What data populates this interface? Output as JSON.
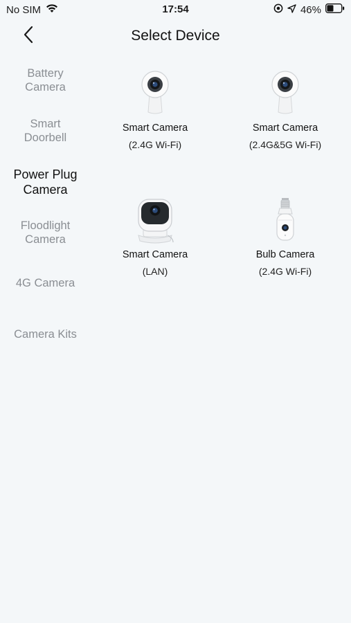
{
  "status_bar": {
    "carrier": "No SIM",
    "time": "17:54",
    "battery": "46%",
    "battery_level": 0.46,
    "icons": [
      "wifi-icon",
      "location-lock-icon",
      "location-arrow-icon",
      "battery-icon"
    ]
  },
  "nav": {
    "title": "Select Device",
    "back_icon": "chevron-left-icon"
  },
  "sidebar": {
    "active_index": 2,
    "items": [
      {
        "line1": "Battery",
        "line2": "Camera"
      },
      {
        "line1": "Smart",
        "line2": "Doorbell"
      },
      {
        "line1": "Power Plug",
        "line2": "Camera"
      },
      {
        "line1": "Floodlight",
        "line2": "Camera"
      },
      {
        "line1": "4G Camera",
        "line2": ""
      },
      {
        "line1": "Camera Kits",
        "line2": ""
      }
    ]
  },
  "devices": [
    {
      "name": "Smart Camera",
      "sub": "(2.4G Wi-Fi)",
      "icon": "indoor-camera-icon"
    },
    {
      "name": "Smart Camera",
      "sub": "(2.4G&5G Wi-Fi)",
      "icon": "indoor-camera-icon"
    },
    {
      "name": "Smart Camera",
      "sub": "(LAN)",
      "icon": "lan-camera-icon"
    },
    {
      "name": "Bulb Camera",
      "sub": "(2.4G Wi-Fi)",
      "icon": "bulb-camera-icon"
    }
  ]
}
